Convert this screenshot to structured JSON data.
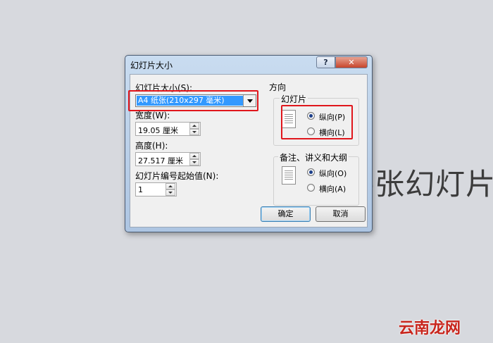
{
  "background": {
    "slide_text": "-张幻灯片",
    "watermark": "云南龙网"
  },
  "dialog": {
    "title": "幻灯片大小",
    "help_label": "?",
    "close_label": "✕",
    "slide_size": {
      "label": "幻灯片大小(S):",
      "selected": "A4 纸张(210x297 毫米)"
    },
    "width": {
      "label": "宽度(W):",
      "value": "19.05 厘米"
    },
    "height": {
      "label": "高度(H):",
      "value": "27.517 厘米"
    },
    "start_number": {
      "label": "幻灯片编号起始值(N):",
      "value": "1"
    },
    "orientation": {
      "title": "方向",
      "slides": {
        "title": "幻灯片",
        "portrait": "纵向(P)",
        "landscape": "横向(L)",
        "selected": "portrait"
      },
      "notes": {
        "title": "备注、讲义和大纲",
        "portrait": "纵向(O)",
        "landscape": "横向(A)",
        "selected": "portrait"
      }
    },
    "ok_label": "确定",
    "cancel_label": "取消"
  },
  "colors": {
    "highlight": "#e0161c",
    "selection": "#3399ff",
    "titlebar": "#c9dcf0"
  }
}
